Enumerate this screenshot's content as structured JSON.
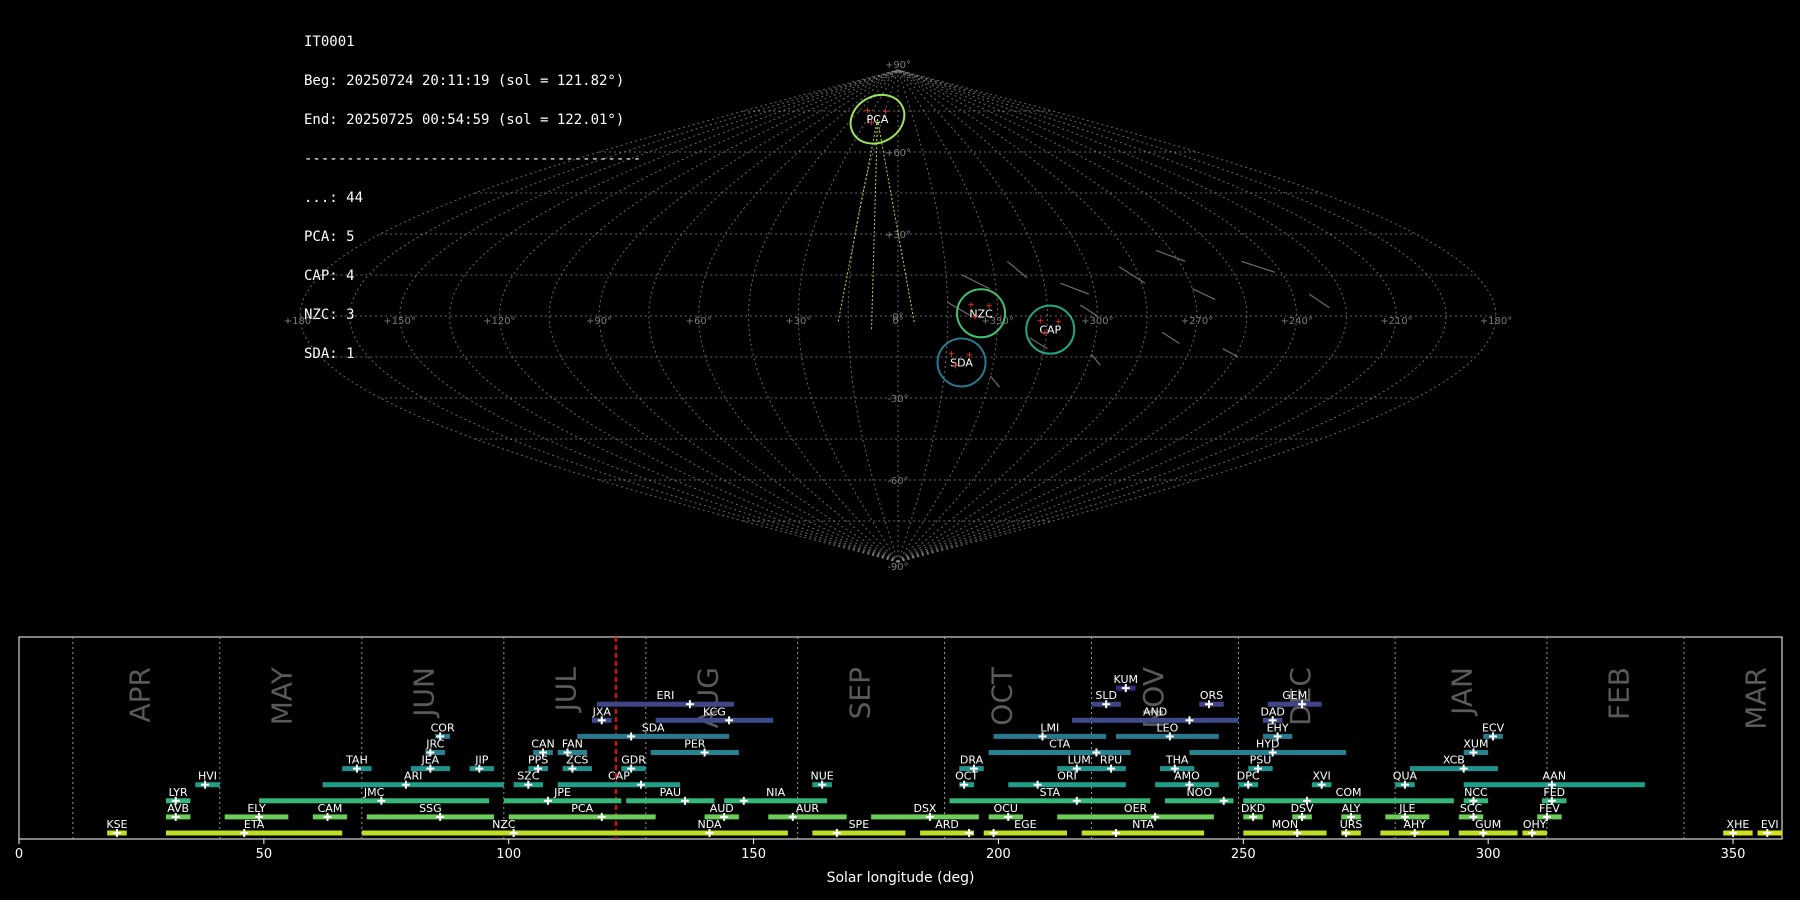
{
  "header": {
    "station": "IT0001",
    "begin": "Beg: 20250724 20:11:19 (sol = 121.82°)",
    "end": "End: 20250725 00:54:59 (sol = 122.01°)",
    "separator": "----------------------------------------",
    "counts": [
      {
        "label": "...: 44"
      },
      {
        "label": "PCA: 5"
      },
      {
        "label": "CAP: 4"
      },
      {
        "label": "NZC: 3"
      },
      {
        "label": "SDA: 1"
      }
    ]
  },
  "colors": {
    "background": "#000000",
    "grid": "#8a8a8a",
    "current_sol": "#ff0000",
    "month_label": "#5a5a5a",
    "viridis": [
      "#3b2a82",
      "#414487",
      "#2a788e",
      "#21918c",
      "#22a884",
      "#44bf70",
      "#7ad151",
      "#bddf26",
      "#d5e21a"
    ]
  },
  "sky_map": {
    "lat_labels": [
      "+90°",
      "+60°",
      "+30°",
      "0°",
      "-30°",
      "-60°",
      "-90°"
    ],
    "lon_labels": [
      "+180°",
      "+150°",
      "+120°",
      "+90°",
      "+60°",
      "+30°",
      "0°",
      "+330°",
      "+300°",
      "+270°",
      "+240°",
      "+210°",
      "+180°"
    ],
    "radiants": [
      {
        "code": "PCA",
        "lon": 20,
        "lat": 72,
        "color": "#9be35a"
      },
      {
        "code": "NZC",
        "lon": -25,
        "lat": 1,
        "color": "#44bf70"
      },
      {
        "code": "CAP",
        "lon": -46,
        "lat": -5,
        "color": "#22a884"
      },
      {
        "code": "SDA",
        "lon": -20,
        "lat": -17,
        "color": "#2a788e"
      }
    ]
  },
  "chart_data": {
    "type": "timeline",
    "xlabel": "Solar longitude (deg)",
    "xlim": [
      0,
      360
    ],
    "x_ticks": [
      0,
      50,
      100,
      150,
      200,
      250,
      300,
      350
    ],
    "current_sol": 121.9,
    "months": [
      {
        "name": "APR",
        "sol": 25
      },
      {
        "name": "MAY",
        "sol": 54
      },
      {
        "name": "JUN",
        "sol": 83
      },
      {
        "name": "JUL",
        "sol": 112
      },
      {
        "name": "AUG",
        "sol": 141
      },
      {
        "name": "SEP",
        "sol": 172
      },
      {
        "name": "OCT",
        "sol": 201
      },
      {
        "name": "NOV",
        "sol": 232
      },
      {
        "name": "DEC",
        "sol": 262
      },
      {
        "name": "JAN",
        "sol": 295
      },
      {
        "name": "FEB",
        "sol": 327
      },
      {
        "name": "MAR",
        "sol": 355
      }
    ],
    "month_dividers": [
      11,
      41,
      70,
      99,
      128,
      159,
      189,
      219,
      249,
      281,
      312,
      340
    ],
    "showers": [
      {
        "code": "KUM",
        "start": 224,
        "end": 228,
        "peak": 226,
        "row": 10,
        "color": "#3b2a82"
      },
      {
        "code": "ERI",
        "start": 118,
        "end": 146,
        "peak": 137,
        "row": 9,
        "color": "#414487"
      },
      {
        "code": "SLD",
        "start": 219,
        "end": 225,
        "peak": 222,
        "row": 9,
        "color": "#414487"
      },
      {
        "code": "ORS",
        "start": 241,
        "end": 246,
        "peak": 243,
        "row": 9,
        "color": "#414487"
      },
      {
        "code": "GEM",
        "start": 255,
        "end": 266,
        "peak": 262,
        "row": 9,
        "color": "#414487"
      },
      {
        "code": "JXA",
        "start": 117,
        "end": 121,
        "peak": 119,
        "row": 8,
        "color": "#3e4a89"
      },
      {
        "code": "KCG",
        "start": 130,
        "end": 154,
        "peak": 145,
        "row": 8,
        "color": "#3e4a89"
      },
      {
        "code": "AND",
        "start": 215,
        "end": 249,
        "peak": 239,
        "row": 8,
        "color": "#3e4a89"
      },
      {
        "code": "DAD",
        "start": 254,
        "end": 258,
        "peak": 256,
        "row": 8,
        "color": "#3e4a89"
      },
      {
        "code": "COR",
        "start": 85,
        "end": 88,
        "peak": 86,
        "row": 7,
        "color": "#2a788e"
      },
      {
        "code": "SDA",
        "start": 114,
        "end": 145,
        "peak": 125,
        "row": 7,
        "color": "#2a788e"
      },
      {
        "code": "LMI",
        "start": 199,
        "end": 222,
        "peak": 209,
        "row": 7,
        "color": "#2a788e"
      },
      {
        "code": "LEO",
        "start": 224,
        "end": 245,
        "peak": 235,
        "row": 7,
        "color": "#2a788e"
      },
      {
        "code": "EHY",
        "start": 254,
        "end": 260,
        "peak": 257,
        "row": 7,
        "color": "#2a788e"
      },
      {
        "code": "ECV",
        "start": 299,
        "end": 303,
        "peak": 301,
        "row": 7,
        "color": "#2a788e"
      },
      {
        "code": "JRC",
        "start": 83,
        "end": 87,
        "peak": 84,
        "row": 6,
        "color": "#26828e"
      },
      {
        "code": "CAN",
        "start": 105,
        "end": 109,
        "peak": 107,
        "row": 6,
        "color": "#26828e"
      },
      {
        "code": "FAN",
        "start": 110,
        "end": 116,
        "peak": 112,
        "row": 6,
        "color": "#26828e"
      },
      {
        "code": "PER",
        "start": 129,
        "end": 147,
        "peak": 140,
        "row": 6,
        "color": "#26828e"
      },
      {
        "code": "CTA",
        "start": 198,
        "end": 227,
        "peak": 220,
        "row": 6,
        "color": "#26828e"
      },
      {
        "code": "HYD",
        "start": 239,
        "end": 271,
        "peak": 256,
        "row": 6,
        "color": "#26828e"
      },
      {
        "code": "XUM",
        "start": 295,
        "end": 300,
        "peak": 297,
        "row": 6,
        "color": "#26828e"
      },
      {
        "code": "TAH",
        "start": 66,
        "end": 72,
        "peak": 69,
        "row": 5,
        "color": "#21918c"
      },
      {
        "code": "JEA",
        "start": 80,
        "end": 88,
        "peak": 84,
        "row": 5,
        "color": "#21918c"
      },
      {
        "code": "JIP",
        "start": 92,
        "end": 97,
        "peak": 94,
        "row": 5,
        "color": "#21918c"
      },
      {
        "code": "PPS",
        "start": 104,
        "end": 108,
        "peak": 106,
        "row": 5,
        "color": "#21918c"
      },
      {
        "code": "ZCS",
        "start": 111,
        "end": 117,
        "peak": 113,
        "row": 5,
        "color": "#21918c"
      },
      {
        "code": "GDR",
        "start": 123,
        "end": 128,
        "peak": 125,
        "row": 5,
        "color": "#21918c"
      },
      {
        "code": "DRA",
        "start": 192,
        "end": 197,
        "peak": 195,
        "row": 5,
        "color": "#21918c"
      },
      {
        "code": "LUM",
        "start": 212,
        "end": 221,
        "peak": 216,
        "row": 5,
        "color": "#21918c"
      },
      {
        "code": "RPU",
        "start": 220,
        "end": 226,
        "peak": 223,
        "row": 5,
        "color": "#21918c"
      },
      {
        "code": "THA",
        "start": 233,
        "end": 240,
        "peak": 236,
        "row": 5,
        "color": "#21918c"
      },
      {
        "code": "PSU",
        "start": 251,
        "end": 256,
        "peak": 253,
        "row": 5,
        "color": "#21918c"
      },
      {
        "code": "XCB",
        "start": 284,
        "end": 302,
        "peak": 295,
        "row": 5,
        "color": "#21918c"
      },
      {
        "code": "HVI",
        "start": 36,
        "end": 41,
        "peak": 38,
        "row": 4,
        "color": "#1f9e89"
      },
      {
        "code": "ARI",
        "start": 62,
        "end": 99,
        "peak": 79,
        "row": 4,
        "color": "#1f9e89"
      },
      {
        "code": "SZC",
        "start": 101,
        "end": 107,
        "peak": 104,
        "row": 4,
        "color": "#1f9e89"
      },
      {
        "code": "CAP",
        "start": 110,
        "end": 135,
        "peak": 127,
        "row": 4,
        "color": "#1f9e89"
      },
      {
        "code": "NUE",
        "start": 162,
        "end": 166,
        "peak": 164,
        "row": 4,
        "color": "#1f9e89"
      },
      {
        "code": "OCT",
        "start": 192,
        "end": 195,
        "peak": 193,
        "row": 4,
        "color": "#1f9e89"
      },
      {
        "code": "ORI",
        "start": 202,
        "end": 226,
        "peak": 208,
        "row": 4,
        "color": "#1f9e89"
      },
      {
        "code": "AMO",
        "start": 232,
        "end": 245,
        "peak": 239,
        "row": 4,
        "color": "#1f9e89"
      },
      {
        "code": "DPC",
        "start": 249,
        "end": 253,
        "peak": 251,
        "row": 4,
        "color": "#1f9e89"
      },
      {
        "code": "XVI",
        "start": 264,
        "end": 268,
        "peak": 266,
        "row": 4,
        "color": "#1f9e89"
      },
      {
        "code": "QUA",
        "start": 281,
        "end": 285,
        "peak": 283,
        "row": 4,
        "color": "#1f9e89"
      },
      {
        "code": "AAN",
        "start": 295,
        "end": 332,
        "peak": 313,
        "row": 4,
        "color": "#1f9e89"
      },
      {
        "code": "LYR",
        "start": 30,
        "end": 35,
        "peak": 32,
        "row": 3,
        "color": "#35b779"
      },
      {
        "code": "JMC",
        "start": 49,
        "end": 96,
        "peak": 74,
        "row": 3,
        "color": "#35b779"
      },
      {
        "code": "JPE",
        "start": 99,
        "end": 123,
        "peak": 108,
        "row": 3,
        "color": "#35b779"
      },
      {
        "code": "PAU",
        "start": 124,
        "end": 142,
        "peak": 136,
        "row": 3,
        "color": "#35b779"
      },
      {
        "code": "NIA",
        "start": 144,
        "end": 165,
        "peak": 148,
        "row": 3,
        "color": "#35b779"
      },
      {
        "code": "STA",
        "start": 190,
        "end": 231,
        "peak": 216,
        "row": 3,
        "color": "#35b779"
      },
      {
        "code": "NOO",
        "start": 234,
        "end": 248,
        "peak": 246,
        "row": 3,
        "color": "#35b779"
      },
      {
        "code": "COM",
        "start": 250,
        "end": 293,
        "peak": 263,
        "row": 3,
        "color": "#35b779"
      },
      {
        "code": "NCC",
        "start": 295,
        "end": 300,
        "peak": 297,
        "row": 3,
        "color": "#35b779"
      },
      {
        "code": "FED",
        "start": 311,
        "end": 316,
        "peak": 313,
        "row": 3,
        "color": "#35b779"
      },
      {
        "code": "AVB",
        "start": 30,
        "end": 35,
        "peak": 32,
        "row": 2,
        "color": "#6ccd5a"
      },
      {
        "code": "ELY",
        "start": 42,
        "end": 55,
        "peak": 49,
        "row": 2,
        "color": "#6ccd5a"
      },
      {
        "code": "CAM",
        "start": 60,
        "end": 67,
        "peak": 63,
        "row": 2,
        "color": "#6ccd5a"
      },
      {
        "code": "SSG",
        "start": 71,
        "end": 97,
        "peak": 86,
        "row": 2,
        "color": "#6ccd5a"
      },
      {
        "code": "PCA",
        "start": 100,
        "end": 130,
        "peak": 119,
        "row": 2,
        "color": "#6ccd5a"
      },
      {
        "code": "AUD",
        "start": 140,
        "end": 147,
        "peak": 144,
        "row": 2,
        "color": "#6ccd5a"
      },
      {
        "code": "AUR",
        "start": 153,
        "end": 169,
        "peak": 158,
        "row": 2,
        "color": "#6ccd5a"
      },
      {
        "code": "DSX",
        "start": 174,
        "end": 196,
        "peak": 186,
        "row": 2,
        "color": "#6ccd5a"
      },
      {
        "code": "OCU",
        "start": 198,
        "end": 205,
        "peak": 202,
        "row": 2,
        "color": "#6ccd5a"
      },
      {
        "code": "OER",
        "start": 212,
        "end": 244,
        "peak": 232,
        "row": 2,
        "color": "#6ccd5a"
      },
      {
        "code": "DKD",
        "start": 250,
        "end": 254,
        "peak": 252,
        "row": 2,
        "color": "#6ccd5a"
      },
      {
        "code": "DSV",
        "start": 260,
        "end": 264,
        "peak": 262,
        "row": 2,
        "color": "#6ccd5a"
      },
      {
        "code": "ALY",
        "start": 270,
        "end": 274,
        "peak": 272,
        "row": 2,
        "color": "#6ccd5a"
      },
      {
        "code": "JLE",
        "start": 279,
        "end": 288,
        "peak": 283,
        "row": 2,
        "color": "#6ccd5a"
      },
      {
        "code": "SCC",
        "start": 294,
        "end": 299,
        "peak": 297,
        "row": 2,
        "color": "#6ccd5a"
      },
      {
        "code": "FEV",
        "start": 310,
        "end": 315,
        "peak": 312,
        "row": 2,
        "color": "#6ccd5a"
      },
      {
        "code": "KSE",
        "start": 18,
        "end": 22,
        "peak": 20,
        "row": 1,
        "color": "#bddf26"
      },
      {
        "code": "ETA",
        "start": 30,
        "end": 66,
        "peak": 46,
        "row": 1,
        "color": "#bddf26"
      },
      {
        "code": "NZC",
        "start": 70,
        "end": 128,
        "peak": 101,
        "row": 1,
        "color": "#bddf26"
      },
      {
        "code": "NDA",
        "start": 125,
        "end": 157,
        "peak": 141,
        "row": 1,
        "color": "#bddf26"
      },
      {
        "code": "SPE",
        "start": 162,
        "end": 181,
        "peak": 167,
        "row": 1,
        "color": "#bddf26"
      },
      {
        "code": "ARD",
        "start": 184,
        "end": 195,
        "peak": 194,
        "row": 1,
        "color": "#bddf26"
      },
      {
        "code": "EGE",
        "start": 197,
        "end": 214,
        "peak": 199,
        "row": 1,
        "color": "#bddf26"
      },
      {
        "code": "NTA",
        "start": 217,
        "end": 242,
        "peak": 224,
        "row": 1,
        "color": "#bddf26"
      },
      {
        "code": "MON",
        "start": 250,
        "end": 267,
        "peak": 261,
        "row": 1,
        "color": "#bddf26"
      },
      {
        "code": "URS",
        "start": 270,
        "end": 274,
        "peak": 271,
        "row": 1,
        "color": "#bddf26"
      },
      {
        "code": "AHY",
        "start": 278,
        "end": 292,
        "peak": 285,
        "row": 1,
        "color": "#bddf26"
      },
      {
        "code": "GUM",
        "start": 294,
        "end": 306,
        "peak": 299,
        "row": 1,
        "color": "#bddf26"
      },
      {
        "code": "OHY",
        "start": 307,
        "end": 312,
        "peak": 309,
        "row": 1,
        "color": "#bddf26"
      },
      {
        "code": "XHE",
        "start": 348,
        "end": 354,
        "peak": 350,
        "row": 1,
        "color": "#d5e21a"
      },
      {
        "code": "EVI",
        "start": 355,
        "end": 360,
        "peak": 357,
        "row": 1,
        "color": "#d5e21a"
      }
    ]
  }
}
